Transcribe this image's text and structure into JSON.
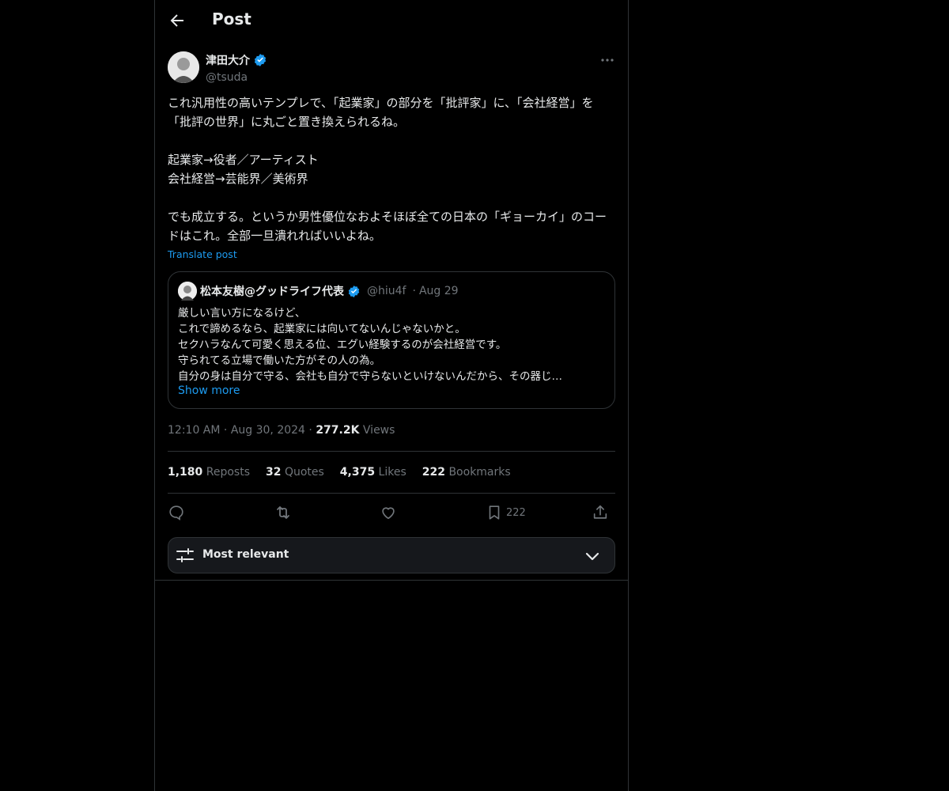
{
  "header": {
    "title": "Post"
  },
  "post": {
    "author_name": "津田大介",
    "handle": "@tsuda",
    "text": "これ汎用性の高いテンプレで、「起業家」の部分を「批評家」に、「会社経営」を「批評の世界」に丸ごと置き換えられるね。\n\n起業家→役者／アーティスト\n会社経営→芸能界／美術界\n\nでも成立する。というか男性優位なおよそほぼ全ての日本の「ギョーカイ」のコードはこれ。全部一旦潰れればいいよね。",
    "translate_label": "Translate post",
    "time": "12:10 AM",
    "date": "Aug 30, 2024",
    "views_count": "277.2K",
    "views_label": "Views"
  },
  "quote": {
    "author_name": "松本友樹@グッドライフ代表",
    "handle": "@hiu4f",
    "date": "Aug 29",
    "text": "厳しい言い方になるけど、\nこれで諦めるなら、起業家には向いてないんじゃないかと。\nセクハラなんて可愛く思える位、エグい経験するのが会社経営です。\n守られてる立場で働いた方がその人の為。\n自分の身は自分で守る、会社も自分で守らないといけないんだから、その器じ…",
    "show_more": "Show more"
  },
  "stats": {
    "reposts_count": "1,180",
    "reposts_label": "Reposts",
    "quotes_count": "32",
    "quotes_label": "Quotes",
    "likes_count": "4,375",
    "likes_label": "Likes",
    "bookmarks_count": "222",
    "bookmarks_label": "Bookmarks"
  },
  "actions": {
    "bookmark_count": "222"
  },
  "sort": {
    "label": "Most relevant"
  },
  "colors": {
    "accent": "#1d9bf0",
    "muted": "#71767b",
    "border": "#2f3336",
    "text": "#e7e9ea"
  },
  "icons": [
    "back-arrow-icon",
    "verified-badge-icon",
    "more-icon",
    "reply-icon",
    "repost-icon",
    "like-icon",
    "bookmark-icon",
    "share-icon",
    "sort-sliders-icon",
    "chevron-down-icon"
  ]
}
